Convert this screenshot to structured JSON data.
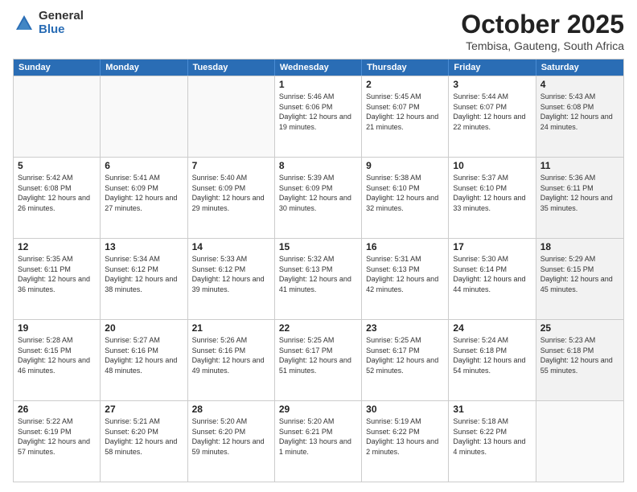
{
  "logo": {
    "general": "General",
    "blue": "Blue"
  },
  "title": "October 2025",
  "subtitle": "Tembisa, Gauteng, South Africa",
  "days_of_week": [
    "Sunday",
    "Monday",
    "Tuesday",
    "Wednesday",
    "Thursday",
    "Friday",
    "Saturday"
  ],
  "weeks": [
    [
      {
        "day": "",
        "info": ""
      },
      {
        "day": "",
        "info": ""
      },
      {
        "day": "",
        "info": ""
      },
      {
        "day": "1",
        "info": "Sunrise: 5:46 AM\nSunset: 6:06 PM\nDaylight: 12 hours\nand 19 minutes."
      },
      {
        "day": "2",
        "info": "Sunrise: 5:45 AM\nSunset: 6:07 PM\nDaylight: 12 hours\nand 21 minutes."
      },
      {
        "day": "3",
        "info": "Sunrise: 5:44 AM\nSunset: 6:07 PM\nDaylight: 12 hours\nand 22 minutes."
      },
      {
        "day": "4",
        "info": "Sunrise: 5:43 AM\nSunset: 6:08 PM\nDaylight: 12 hours\nand 24 minutes."
      }
    ],
    [
      {
        "day": "5",
        "info": "Sunrise: 5:42 AM\nSunset: 6:08 PM\nDaylight: 12 hours\nand 26 minutes."
      },
      {
        "day": "6",
        "info": "Sunrise: 5:41 AM\nSunset: 6:09 PM\nDaylight: 12 hours\nand 27 minutes."
      },
      {
        "day": "7",
        "info": "Sunrise: 5:40 AM\nSunset: 6:09 PM\nDaylight: 12 hours\nand 29 minutes."
      },
      {
        "day": "8",
        "info": "Sunrise: 5:39 AM\nSunset: 6:09 PM\nDaylight: 12 hours\nand 30 minutes."
      },
      {
        "day": "9",
        "info": "Sunrise: 5:38 AM\nSunset: 6:10 PM\nDaylight: 12 hours\nand 32 minutes."
      },
      {
        "day": "10",
        "info": "Sunrise: 5:37 AM\nSunset: 6:10 PM\nDaylight: 12 hours\nand 33 minutes."
      },
      {
        "day": "11",
        "info": "Sunrise: 5:36 AM\nSunset: 6:11 PM\nDaylight: 12 hours\nand 35 minutes."
      }
    ],
    [
      {
        "day": "12",
        "info": "Sunrise: 5:35 AM\nSunset: 6:11 PM\nDaylight: 12 hours\nand 36 minutes."
      },
      {
        "day": "13",
        "info": "Sunrise: 5:34 AM\nSunset: 6:12 PM\nDaylight: 12 hours\nand 38 minutes."
      },
      {
        "day": "14",
        "info": "Sunrise: 5:33 AM\nSunset: 6:12 PM\nDaylight: 12 hours\nand 39 minutes."
      },
      {
        "day": "15",
        "info": "Sunrise: 5:32 AM\nSunset: 6:13 PM\nDaylight: 12 hours\nand 41 minutes."
      },
      {
        "day": "16",
        "info": "Sunrise: 5:31 AM\nSunset: 6:13 PM\nDaylight: 12 hours\nand 42 minutes."
      },
      {
        "day": "17",
        "info": "Sunrise: 5:30 AM\nSunset: 6:14 PM\nDaylight: 12 hours\nand 44 minutes."
      },
      {
        "day": "18",
        "info": "Sunrise: 5:29 AM\nSunset: 6:15 PM\nDaylight: 12 hours\nand 45 minutes."
      }
    ],
    [
      {
        "day": "19",
        "info": "Sunrise: 5:28 AM\nSunset: 6:15 PM\nDaylight: 12 hours\nand 46 minutes."
      },
      {
        "day": "20",
        "info": "Sunrise: 5:27 AM\nSunset: 6:16 PM\nDaylight: 12 hours\nand 48 minutes."
      },
      {
        "day": "21",
        "info": "Sunrise: 5:26 AM\nSunset: 6:16 PM\nDaylight: 12 hours\nand 49 minutes."
      },
      {
        "day": "22",
        "info": "Sunrise: 5:25 AM\nSunset: 6:17 PM\nDaylight: 12 hours\nand 51 minutes."
      },
      {
        "day": "23",
        "info": "Sunrise: 5:25 AM\nSunset: 6:17 PM\nDaylight: 12 hours\nand 52 minutes."
      },
      {
        "day": "24",
        "info": "Sunrise: 5:24 AM\nSunset: 6:18 PM\nDaylight: 12 hours\nand 54 minutes."
      },
      {
        "day": "25",
        "info": "Sunrise: 5:23 AM\nSunset: 6:18 PM\nDaylight: 12 hours\nand 55 minutes."
      }
    ],
    [
      {
        "day": "26",
        "info": "Sunrise: 5:22 AM\nSunset: 6:19 PM\nDaylight: 12 hours\nand 57 minutes."
      },
      {
        "day": "27",
        "info": "Sunrise: 5:21 AM\nSunset: 6:20 PM\nDaylight: 12 hours\nand 58 minutes."
      },
      {
        "day": "28",
        "info": "Sunrise: 5:20 AM\nSunset: 6:20 PM\nDaylight: 12 hours\nand 59 minutes."
      },
      {
        "day": "29",
        "info": "Sunrise: 5:20 AM\nSunset: 6:21 PM\nDaylight: 13 hours\nand 1 minute."
      },
      {
        "day": "30",
        "info": "Sunrise: 5:19 AM\nSunset: 6:22 PM\nDaylight: 13 hours\nand 2 minutes."
      },
      {
        "day": "31",
        "info": "Sunrise: 5:18 AM\nSunset: 6:22 PM\nDaylight: 13 hours\nand 4 minutes."
      },
      {
        "day": "",
        "info": ""
      }
    ]
  ]
}
